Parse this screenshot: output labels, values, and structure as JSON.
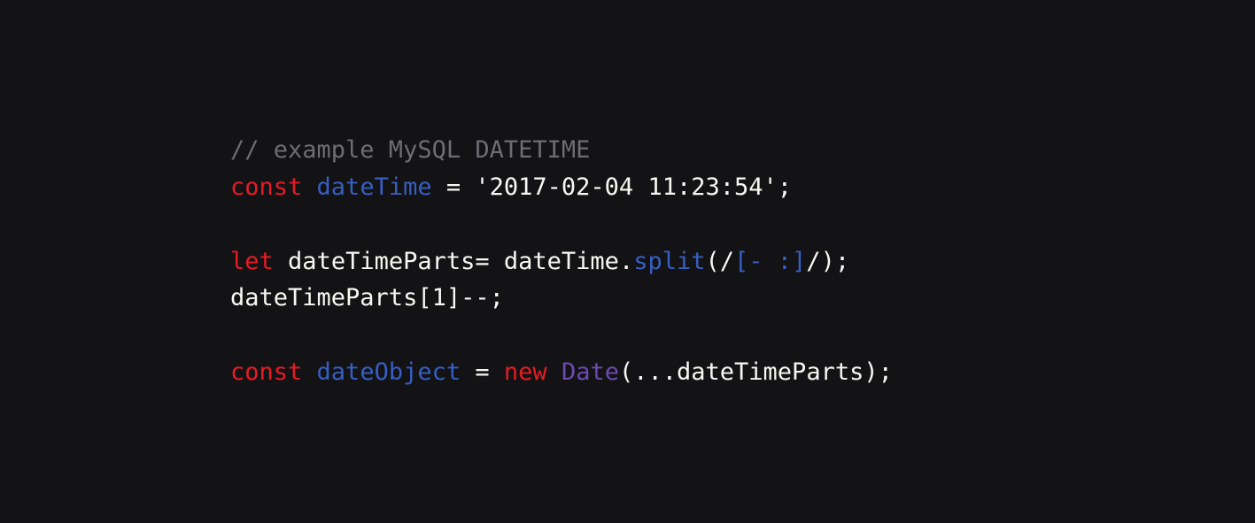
{
  "code": {
    "line1": {
      "comment": "// example MySQL DATETIME"
    },
    "line2": {
      "const": "const",
      "var": "dateTime",
      "eq": " = ",
      "string": "'2017-02-04 11:23:54'",
      "semi": ";"
    },
    "line4": {
      "let": "let",
      "var": "dateTimeParts",
      "eq": "= ",
      "obj": "dateTime",
      "dot": ".",
      "method": "split",
      "open": "(",
      "regex_open": "/",
      "regex_class": "[- :]",
      "regex_close": "/",
      "close": ")",
      "semi": ";"
    },
    "line5": {
      "var": "dateTimeParts",
      "bracket_open": "[",
      "index": "1",
      "bracket_close": "]",
      "decr": "--",
      "semi": ";"
    },
    "line7": {
      "const": "const",
      "var": "dateObject",
      "eq": " = ",
      "new": "new",
      "class": "Date",
      "open": "(",
      "spread": "...",
      "arg": "dateTimeParts",
      "close": ")",
      "semi": ";"
    }
  }
}
